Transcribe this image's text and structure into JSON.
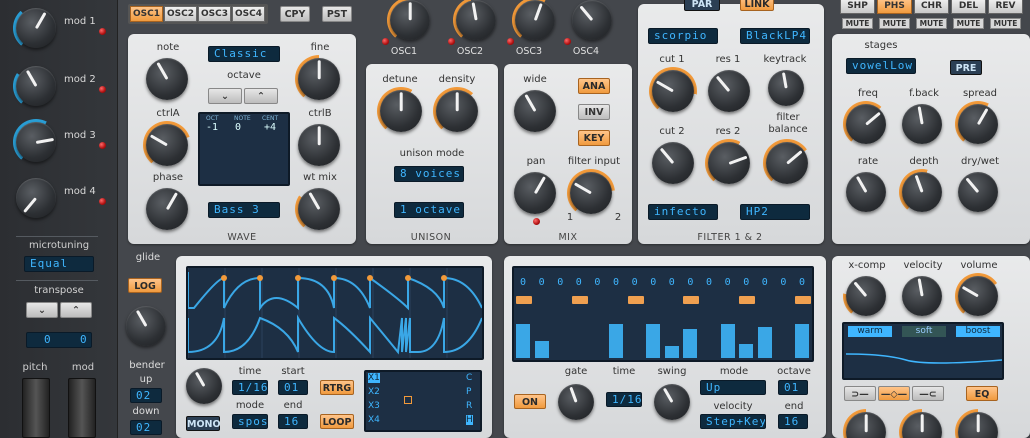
{
  "left": {
    "mods": [
      "mod 1",
      "mod 2",
      "mod 3",
      "mod 4"
    ],
    "microtuning_label": "microtuning",
    "microtuning_value": "Equal",
    "transpose_label": "transpose",
    "transpose_values": [
      "0",
      "0"
    ],
    "pitch_label": "pitch",
    "mod_label": "mod"
  },
  "osc_tabs": [
    "OSC1",
    "OSC2",
    "OSC3",
    "OSC4"
  ],
  "copy_label": "CPY",
  "paste_label": "PST",
  "osc_level_labels": [
    "OSC1",
    "OSC2",
    "OSC3",
    "OSC4"
  ],
  "wave": {
    "note": "note",
    "fine": "fine",
    "ctrlA": "ctrlA",
    "ctrlB": "ctrlB",
    "phase": "phase",
    "wt_mix": "wt mix",
    "octave": "octave",
    "wave_select": "Classic",
    "bass_select": "Bass 3",
    "title": "WAVE",
    "display": {
      "headers": [
        "OCT",
        "NOTE",
        "CENT"
      ],
      "values": [
        "-1",
        "0",
        "+4"
      ]
    }
  },
  "unison": {
    "detune": "detune",
    "density": "density",
    "mode_label": "unison mode",
    "voices": "8 voices",
    "octave": "1 octave",
    "title": "UNISON"
  },
  "mix": {
    "wide": "wide",
    "pan": "pan",
    "filter_input": "filter input",
    "fi1": "1",
    "fi2": "2",
    "title": "MIX",
    "ana": "ANA",
    "inv": "INV",
    "key": "KEY"
  },
  "filter": {
    "par": "PAR",
    "link": "LINK",
    "type1": "scorpio",
    "type2": "BlackLP4",
    "cut1": "cut 1",
    "res1": "res 1",
    "keytrack": "keytrack",
    "cut2": "cut 2",
    "res2": "res 2",
    "balance": "filter\nbalance",
    "type3": "infecto",
    "type4": "HP2",
    "title": "FILTER 1 & 2"
  },
  "fx_tabs": [
    "SHP",
    "PHS",
    "CHR",
    "DEL",
    "REV"
  ],
  "mute": "MUTE",
  "fx": {
    "stages": "stages",
    "stages_val": "vowelLow",
    "pre": "PRE",
    "freq": "freq",
    "fback": "f.back",
    "spread": "spread",
    "rate": "rate",
    "depth": "depth",
    "drywet": "dry/wet"
  },
  "glide": {
    "glide": "glide",
    "log": "LOG",
    "bender": "bender",
    "up": "up",
    "up_val": "02",
    "down": "down",
    "down_val": "02"
  },
  "lfo": {
    "time": "time",
    "start": "start",
    "time_val": "1/16",
    "start_val": "01",
    "rtrg": "RTRG",
    "mode": "mode",
    "end": "end",
    "mode_val": "spos",
    "end_val": "16",
    "loop": "LOOP",
    "mono": "MONO",
    "xlist": [
      "X1",
      "X2",
      "X3",
      "X4"
    ],
    "cprh": [
      "C",
      "P",
      "R",
      "H"
    ]
  },
  "seq": {
    "zeros": [
      "0",
      "0",
      "0",
      "0",
      "0",
      "0",
      "0",
      "0",
      "0",
      "0",
      "0",
      "0",
      "0",
      "0",
      "0",
      "0"
    ],
    "steps": [
      0.7,
      0.35,
      0,
      0,
      0,
      0.7,
      0,
      0.7,
      0.25,
      0.6,
      0,
      0.7,
      0.3,
      0.65,
      0,
      0.7
    ],
    "on": "ON",
    "gate": "gate",
    "time": "time",
    "swing": "swing",
    "mode": "mode",
    "octave": "octave",
    "time_val": "1/16",
    "mode_val": "Up",
    "octave_val": "01",
    "velocity": "velocity",
    "end": "end",
    "vel_val": "Step+Key",
    "end_val": "16"
  },
  "master": {
    "xcomp": "x-comp",
    "velocity": "velocity",
    "volume": "volume",
    "warm": "warm",
    "soft": "soft",
    "boost": "boost",
    "eq": "EQ"
  }
}
